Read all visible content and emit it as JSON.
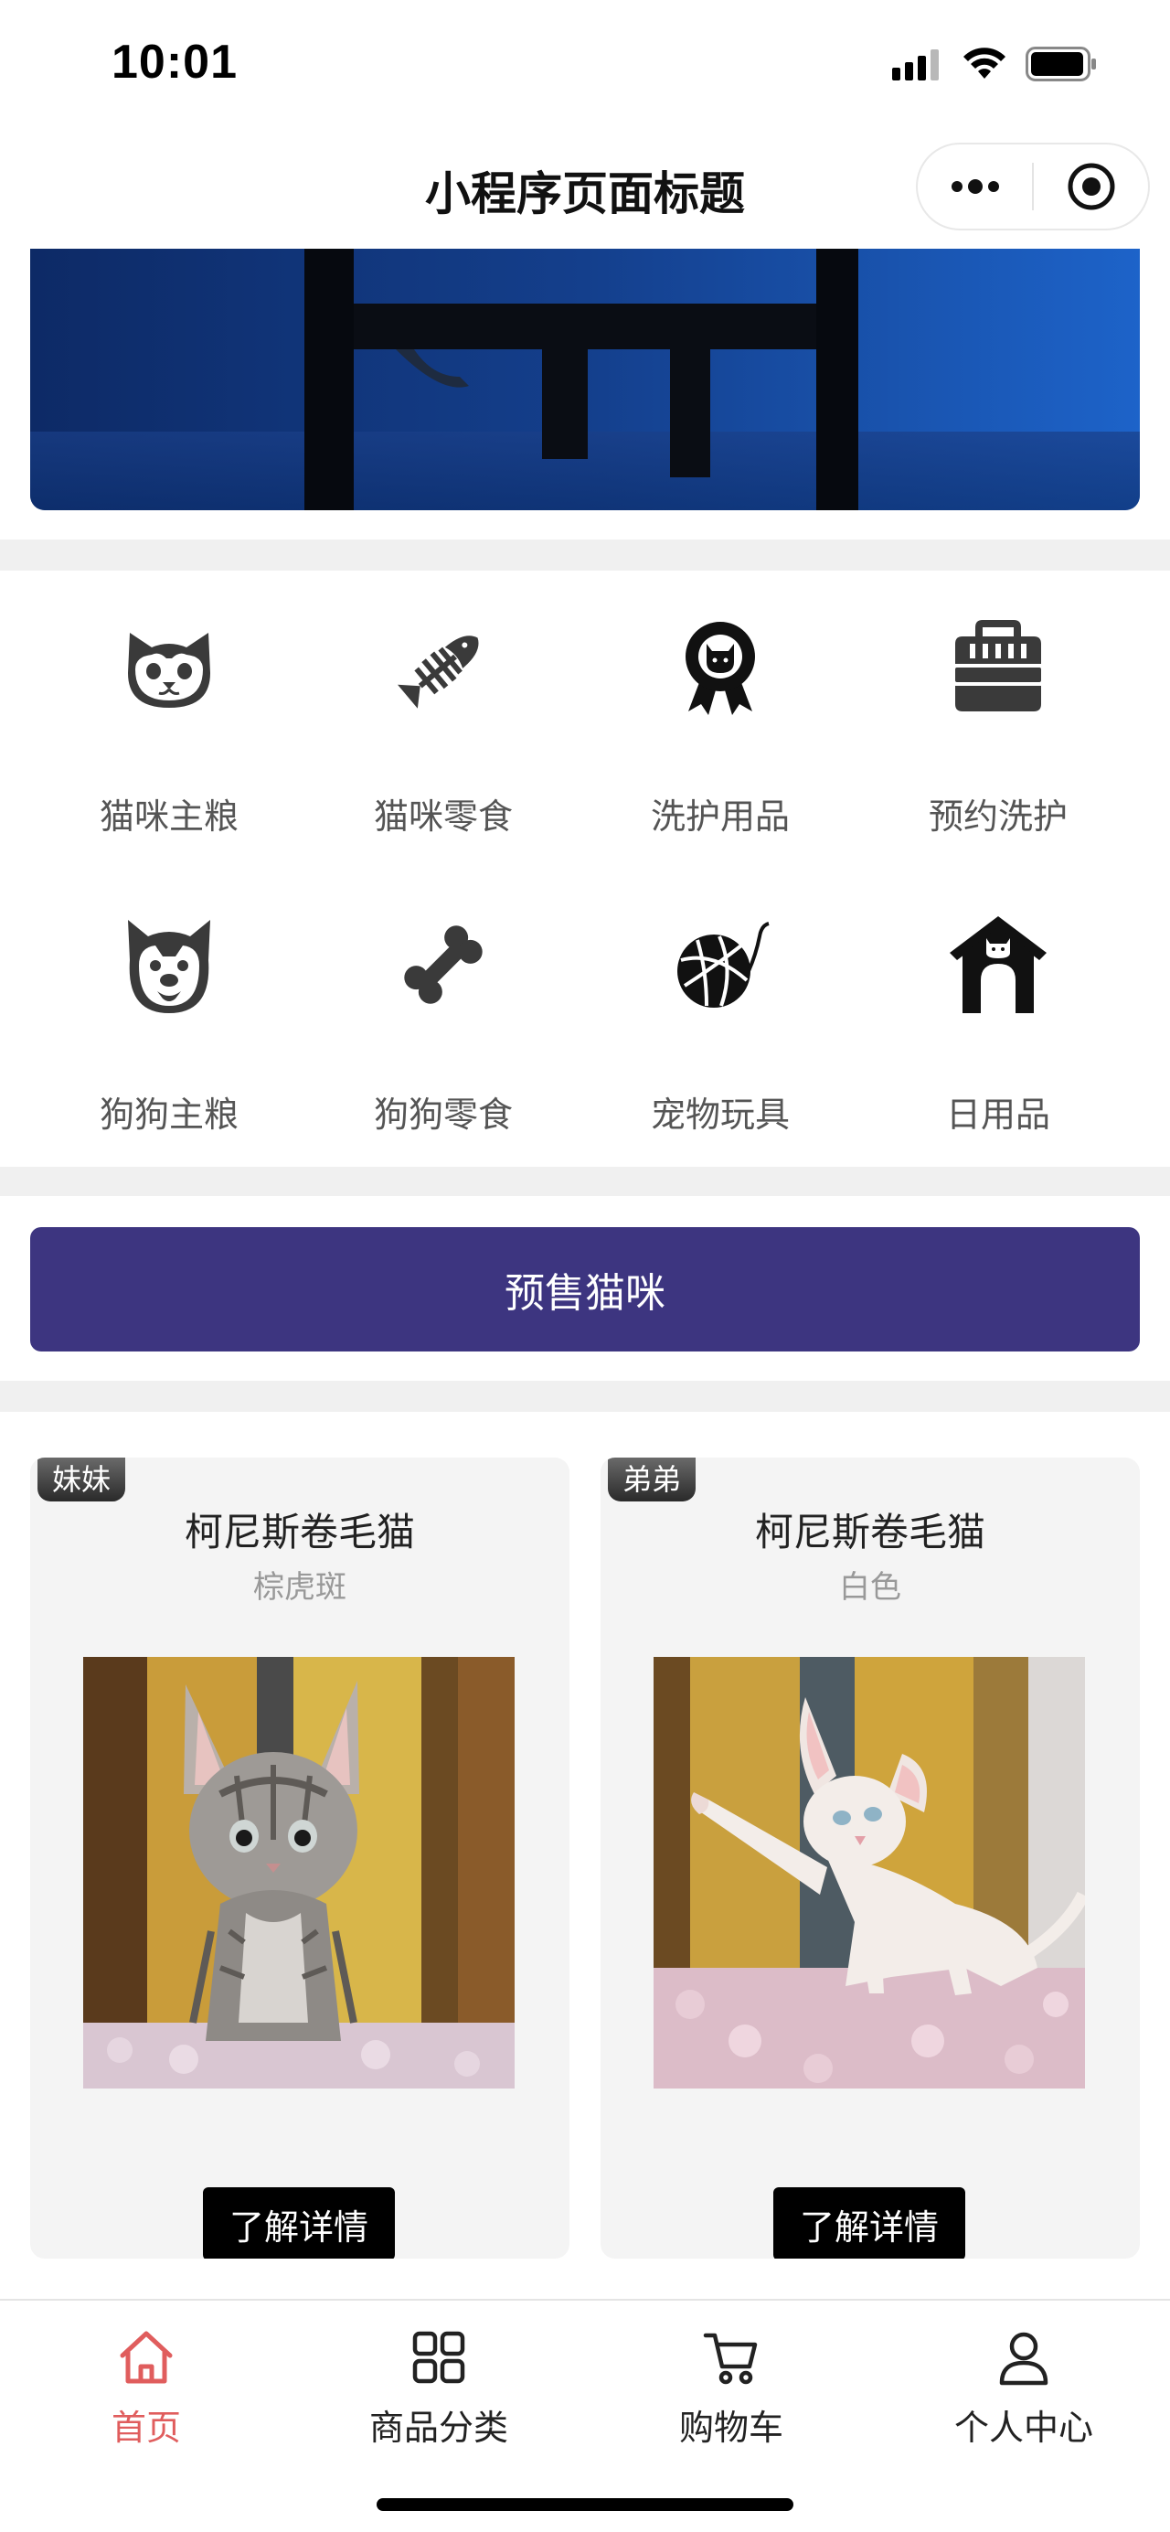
{
  "status_bar": {
    "time": "10:01",
    "icons": [
      "signal-icon",
      "wifi-icon",
      "battery-icon"
    ]
  },
  "nav": {
    "title": "小程序页面标题",
    "menu_icon": "more-dots-icon",
    "close_icon": "target-icon"
  },
  "categories": [
    {
      "label": "猫咪主粮",
      "icon": "cat-face-icon"
    },
    {
      "label": "猫咪零食",
      "icon": "fish-bone-icon"
    },
    {
      "label": "洗护用品",
      "icon": "award-ribbon-icon"
    },
    {
      "label": "预约洗护",
      "icon": "pet-carrier-icon"
    },
    {
      "label": "狗狗主粮",
      "icon": "dog-face-icon"
    },
    {
      "label": "狗狗零食",
      "icon": "bone-icon"
    },
    {
      "label": "宠物玩具",
      "icon": "yarn-ball-icon"
    },
    {
      "label": "日用品",
      "icon": "pet-house-icon"
    }
  ],
  "presale": {
    "label": "预售猫咪"
  },
  "products": [
    {
      "tag": "妹妹",
      "name": "柯尼斯卷毛猫",
      "color": "棕虎斑",
      "button": "了解详情"
    },
    {
      "tag": "弟弟",
      "name": "柯尼斯卷毛猫",
      "color": "白色",
      "button": "了解详情"
    }
  ],
  "tab_bar": [
    {
      "label": "首页",
      "icon": "home-icon",
      "active": true
    },
    {
      "label": "商品分类",
      "icon": "grid-icon",
      "active": false
    },
    {
      "label": "购物车",
      "icon": "cart-icon",
      "active": false
    },
    {
      "label": "个人中心",
      "icon": "user-icon",
      "active": false
    }
  ],
  "colors": {
    "accent_active": "#e05d5d",
    "presale_bg": "#3d3580",
    "divider_band": "#f0f0f0",
    "card_bg": "#f4f4f4"
  }
}
